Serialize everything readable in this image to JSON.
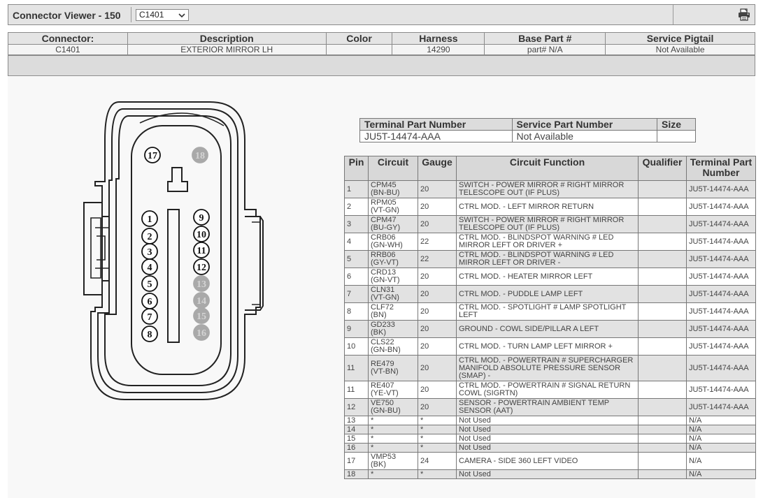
{
  "app": {
    "title": "Connector Viewer - 150",
    "selected_connector": "C1401",
    "print_icon": "printer-icon"
  },
  "header_table": {
    "columns": [
      "Connector:",
      "Description",
      "Color",
      "Harness",
      "Base Part #",
      "Service Pigtail"
    ],
    "row": [
      "C1401",
      "EXTERIOR MIRROR LH",
      "",
      "14290",
      "part# N/A",
      "Not Available"
    ]
  },
  "diagram": {
    "top_pins": [
      "17",
      "18"
    ],
    "left_pins": [
      "1",
      "2",
      "3",
      "4",
      "5",
      "6",
      "7",
      "8"
    ],
    "right_pins": [
      "9",
      "10",
      "11",
      "12",
      "13",
      "14",
      "15",
      "16"
    ],
    "unused_pins": [
      "13",
      "14",
      "15",
      "16",
      "18"
    ]
  },
  "part_table": {
    "columns": [
      "Terminal Part Number",
      "Service Part Number",
      "Size"
    ],
    "row": [
      "JU5T-14474-AAA",
      "Not Available",
      ""
    ]
  },
  "pin_table": {
    "columns": [
      "Pin",
      "Circuit",
      "Gauge",
      "Circuit Function",
      "Qualifier",
      "Terminal Part Number"
    ],
    "rows": [
      {
        "pin": "1",
        "circuit": "CPM45",
        "color": "(BN-BU)",
        "gauge": "20",
        "function": "SWITCH - POWER MIRROR # RIGHT MIRROR TELESCOPE OUT (IF PLUS)",
        "qualifier": "",
        "terminal": "JU5T-14474-AAA"
      },
      {
        "pin": "2",
        "circuit": "RPM05",
        "color": "(VT-GN)",
        "gauge": "20",
        "function": "CTRL MOD. - LEFT MIRROR RETURN",
        "qualifier": "",
        "terminal": "JU5T-14474-AAA"
      },
      {
        "pin": "3",
        "circuit": "CPM47",
        "color": "(BU-GY)",
        "gauge": "20",
        "function": "SWITCH - POWER MIRROR # RIGHT MIRROR TELESCOPE OUT (IF PLUS)",
        "qualifier": "",
        "terminal": "JU5T-14474-AAA"
      },
      {
        "pin": "4",
        "circuit": "CRB06",
        "color": "(GN-WH)",
        "gauge": "22",
        "function": "CTRL MOD. - BLINDSPOT WARNING # LED MIRROR LEFT OR DRIVER +",
        "qualifier": "",
        "terminal": "JU5T-14474-AAA"
      },
      {
        "pin": "5",
        "circuit": "RRB06",
        "color": "(GY-VT)",
        "gauge": "22",
        "function": "CTRL MOD. - BLINDSPOT WARNING # LED MIRROR LEFT OR DRIVER -",
        "qualifier": "",
        "terminal": "JU5T-14474-AAA"
      },
      {
        "pin": "6",
        "circuit": "CRD13",
        "color": "(GN-VT)",
        "gauge": "20",
        "function": "CTRL MOD. - HEATER MIRROR LEFT",
        "qualifier": "",
        "terminal": "JU5T-14474-AAA"
      },
      {
        "pin": "7",
        "circuit": "CLN31",
        "color": "(VT-GN)",
        "gauge": "20",
        "function": "CTRL MOD. - PUDDLE LAMP LEFT",
        "qualifier": "",
        "terminal": "JU5T-14474-AAA"
      },
      {
        "pin": "8",
        "circuit": "CLF72",
        "color": "(BN)",
        "gauge": "20",
        "function": "CTRL MOD. - SPOTLIGHT # LAMP SPOTLIGHT LEFT",
        "qualifier": "",
        "terminal": "JU5T-14474-AAA"
      },
      {
        "pin": "9",
        "circuit": "GD233",
        "color": "(BK)",
        "gauge": "20",
        "function": "GROUND - COWL SIDE/PILLAR A LEFT",
        "qualifier": "",
        "terminal": "JU5T-14474-AAA"
      },
      {
        "pin": "10",
        "circuit": "CLS22",
        "color": "(GN-BN)",
        "gauge": "20",
        "function": "CTRL MOD. - TURN LAMP LEFT MIRROR +",
        "qualifier": "",
        "terminal": "JU5T-14474-AAA"
      },
      {
        "pin": "11",
        "circuit": "RE479",
        "color": "(VT-BN)",
        "gauge": "20",
        "function": "CTRL MOD. - POWERTRAIN # SUPERCHARGER MANIFOLD ABSOLUTE PRESSURE SENSOR (SMAP) -",
        "qualifier": "",
        "terminal": "JU5T-14474-AAA"
      },
      {
        "pin": "11",
        "circuit": "RE407",
        "color": "(YE-VT)",
        "gauge": "20",
        "function": "CTRL MOD. - POWERTRAIN # SIGNAL RETURN COWL (SIGRTN)",
        "qualifier": "",
        "terminal": "JU5T-14474-AAA"
      },
      {
        "pin": "12",
        "circuit": "VE750",
        "color": "(GN-BU)",
        "gauge": "20",
        "function": "SENSOR - POWERTRAIN AMBIENT TEMP SENSOR (AAT)",
        "qualifier": "",
        "terminal": "JU5T-14474-AAA"
      },
      {
        "pin": "13",
        "circuit": "*",
        "color": "",
        "gauge": "*",
        "function": "Not Used",
        "qualifier": "",
        "terminal": "N/A"
      },
      {
        "pin": "14",
        "circuit": "*",
        "color": "",
        "gauge": "*",
        "function": "Not Used",
        "qualifier": "",
        "terminal": "N/A"
      },
      {
        "pin": "15",
        "circuit": "*",
        "color": "",
        "gauge": "*",
        "function": "Not Used",
        "qualifier": "",
        "terminal": "N/A"
      },
      {
        "pin": "16",
        "circuit": "*",
        "color": "",
        "gauge": "*",
        "function": "Not Used",
        "qualifier": "",
        "terminal": "N/A"
      },
      {
        "pin": "17",
        "circuit": "VMP53",
        "color": "(BK)",
        "gauge": "24",
        "function": "CAMERA - SIDE 360 LEFT VIDEO",
        "qualifier": "",
        "terminal": "N/A"
      },
      {
        "pin": "18",
        "circuit": "*",
        "color": "",
        "gauge": "*",
        "function": "Not Used",
        "qualifier": "",
        "terminal": "N/A"
      }
    ]
  }
}
